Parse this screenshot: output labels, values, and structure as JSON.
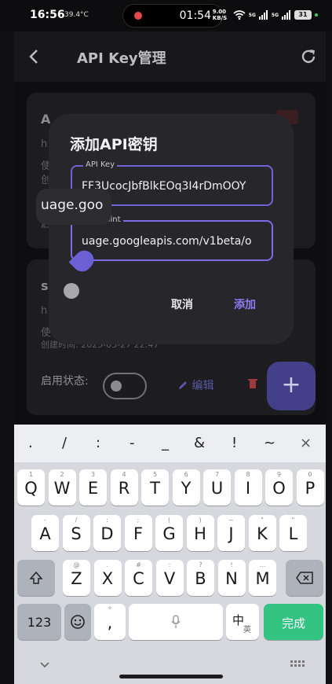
{
  "status_bar": {
    "time": "16:56",
    "temperature": "39.4°C",
    "recording_timer": "01:54",
    "network_speed": "9.00 KB/S",
    "signal_1": "5G",
    "signal_2": "5G",
    "battery": "31"
  },
  "app_bar": {
    "title": "API Key管理",
    "back_icon": "arrow-left-icon",
    "refresh_icon": "refresh-icon"
  },
  "background_cards": {
    "card1_header": "A",
    "card1_line1": "h",
    "card1_line2": "使",
    "card1_line3": "创",
    "card1_line4": "启",
    "card2_header": "s",
    "card2_line1": "h",
    "card2_line2": "使",
    "card2_created": "创建时间: 2025-03-27 22:47",
    "status_label": "启用状态:",
    "edit_label": "编辑",
    "fab_label": "+"
  },
  "dialog": {
    "title": "添加API密钥",
    "api_key_label": "API Key",
    "api_key_value": "FF3UcocJbfBlkEOq3I4rDmOOY",
    "endpoint_label": "Endpoint",
    "endpoint_value": "uage.googleapis.com/v1beta/o",
    "magnifier_text": "uage.goo",
    "cancel_label": "取消",
    "add_label": "添加"
  },
  "keyboard": {
    "symbols": [
      ".",
      "/",
      ":",
      "-",
      "_",
      "&",
      "!",
      "~",
      "×"
    ],
    "row1": [
      {
        "k": "Q",
        "h": "1"
      },
      {
        "k": "W",
        "h": "2"
      },
      {
        "k": "E",
        "h": "3"
      },
      {
        "k": "R",
        "h": "4"
      },
      {
        "k": "T",
        "h": "5"
      },
      {
        "k": "Y",
        "h": "6"
      },
      {
        "k": "U",
        "h": "7"
      },
      {
        "k": "I",
        "h": "8"
      },
      {
        "k": "O",
        "h": "9"
      },
      {
        "k": "P",
        "h": "0"
      }
    ],
    "row2": [
      {
        "k": "A",
        "h": "-"
      },
      {
        "k": "S",
        "h": "/"
      },
      {
        "k": "D",
        "h": ":"
      },
      {
        "k": "F",
        "h": ";"
      },
      {
        "k": "G",
        "h": "("
      },
      {
        "k": "H",
        "h": ")"
      },
      {
        "k": "J",
        "h": "~"
      },
      {
        "k": "K",
        "h": "\""
      },
      {
        "k": "L",
        "h": "“"
      }
    ],
    "row3": [
      {
        "k": "Z",
        "h": "@"
      },
      {
        "k": "X",
        "h": "."
      },
      {
        "k": "C",
        "h": "#"
      },
      {
        "k": "V",
        "h": ":"
      },
      {
        "k": "B",
        "h": "?"
      },
      {
        "k": "N",
        "h": "!"
      },
      {
        "k": "M",
        "h": "…"
      }
    ],
    "shift_icon": "shift-icon",
    "backspace_icon": "backspace-icon",
    "num_label": "123",
    "emoji_icon": "emoji-icon",
    "comma_label": ",",
    "comma_hint": "°",
    "mic_icon": "microphone-icon",
    "lang_label": "中",
    "lang_sub": "英",
    "done_label": "完成",
    "collapse_icon": "chevron-down-icon",
    "grid_icon": "keyboard-icon"
  }
}
